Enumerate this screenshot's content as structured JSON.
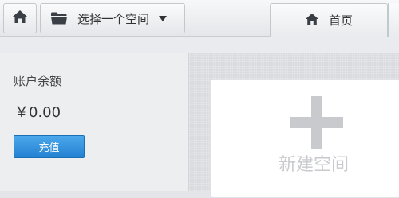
{
  "topbar": {
    "home_icon": "home-icon",
    "space_selector": {
      "icon": "folder-icon",
      "label": "选择一个空间",
      "caret_icon": "caret-down-icon"
    },
    "tabs": [
      {
        "label": "首页",
        "icon": "home-icon"
      }
    ]
  },
  "account": {
    "balance_label": "账户余额",
    "balance_value": "￥0.00",
    "recharge_label": "充值"
  },
  "main": {
    "new_space_icon": "plus-icon",
    "new_space_label": "新建空间"
  },
  "colors": {
    "accent": "#2381d2",
    "icon": "#3a3f45",
    "placeholder": "#c8cacd"
  }
}
